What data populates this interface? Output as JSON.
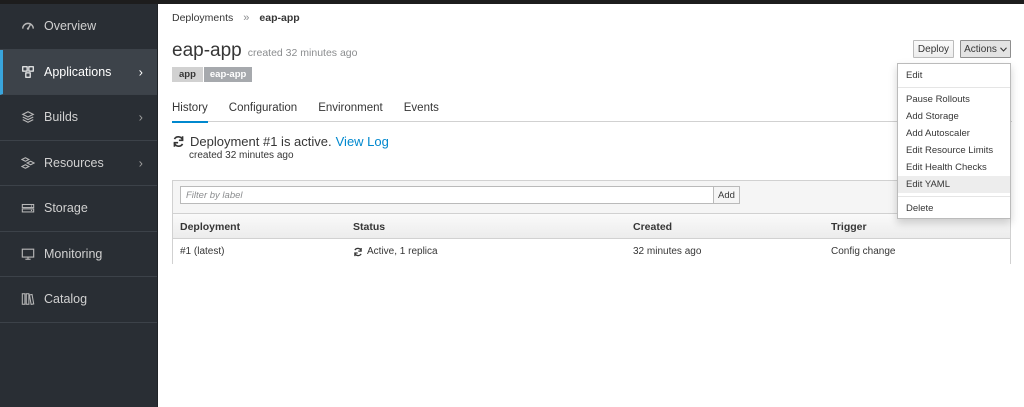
{
  "sidebar": {
    "items": [
      {
        "label": "Overview",
        "icon": "dashboard-icon",
        "has_chevron": false,
        "active": false
      },
      {
        "label": "Applications",
        "icon": "cubes-icon",
        "has_chevron": true,
        "active": true
      },
      {
        "label": "Builds",
        "icon": "layers-icon",
        "has_chevron": true,
        "active": false
      },
      {
        "label": "Resources",
        "icon": "cubes-outline-icon",
        "has_chevron": true,
        "active": false
      },
      {
        "label": "Storage",
        "icon": "storage-icon",
        "has_chevron": false,
        "active": false
      },
      {
        "label": "Monitoring",
        "icon": "monitor-icon",
        "has_chevron": false,
        "active": false
      },
      {
        "label": "Catalog",
        "icon": "catalog-icon",
        "has_chevron": false,
        "active": false
      }
    ],
    "chevron": "›"
  },
  "breadcrumb": {
    "parent": "Deployments",
    "separator": "»",
    "current": "eap-app"
  },
  "header": {
    "title": "eap-app",
    "created": "created 32 minutes ago",
    "label_key": "app",
    "label_value": "eap-app",
    "deploy_label": "Deploy",
    "actions_label": "Actions"
  },
  "tabs": [
    {
      "label": "History",
      "active": true
    },
    {
      "label": "Configuration",
      "active": false
    },
    {
      "label": "Environment",
      "active": false
    },
    {
      "label": "Events",
      "active": false
    }
  ],
  "status": {
    "prefix": "Deployment #1 is active.",
    "link": "View Log",
    "sub": "created 32 minutes ago"
  },
  "filter": {
    "placeholder": "Filter by label",
    "add_label": "Add"
  },
  "table": {
    "headers": [
      "Deployment",
      "Status",
      "Created",
      "Trigger"
    ],
    "rows": [
      {
        "deployment": "#1 (latest)",
        "status": "Active, 1 replica",
        "created": "32 minutes ago",
        "trigger": "Config change"
      }
    ]
  },
  "actions_menu": {
    "items": [
      "Edit",
      "Pause Rollouts",
      "Add Storage",
      "Add Autoscaler",
      "Edit Resource Limits",
      "Edit Health Checks",
      "Edit YAML",
      "Delete"
    ],
    "hovered": "Edit YAML"
  },
  "colors": {
    "sidebar_bg": "#292e34",
    "accent": "#0088ce",
    "active_border": "#39a5dc"
  }
}
